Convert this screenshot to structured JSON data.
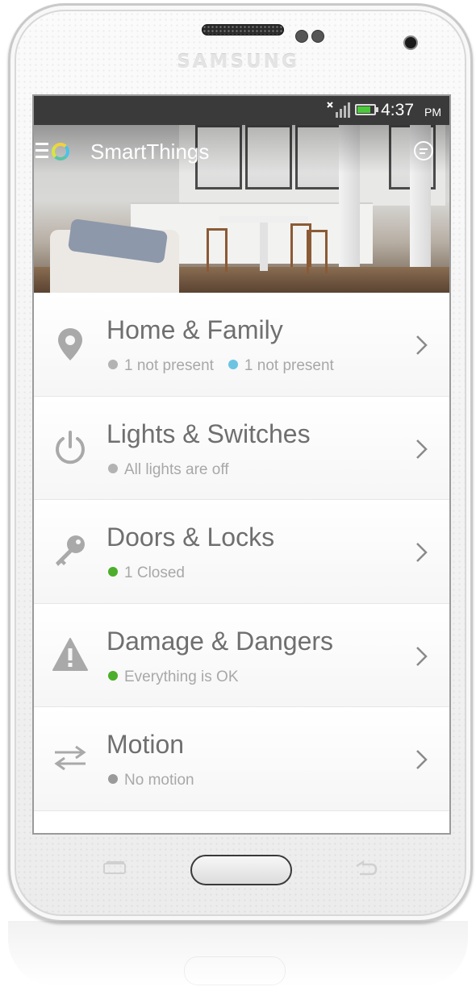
{
  "device": {
    "brand": "SAMSUNG"
  },
  "status_bar": {
    "time": "4:37",
    "ampm": "PM",
    "battery_level": 0.8,
    "icons": [
      "signal-icon",
      "battery-icon"
    ]
  },
  "app_bar": {
    "title": "SmartThings",
    "icons": [
      "menu-icon",
      "smartthings-logo-icon",
      "chat-icon"
    ]
  },
  "colors": {
    "accent_green": "#4cae2a",
    "accent_blue": "#6cc4e2",
    "neutral_gray": "#b3b3b3"
  },
  "list": {
    "items": [
      {
        "title": "Home & Family",
        "icon": "location-pin-icon",
        "statuses": [
          {
            "text": "1 not present",
            "dot_color": "#b3b3b3"
          },
          {
            "text": "1 not present",
            "dot_color": "#6cc4e2"
          }
        ]
      },
      {
        "title": "Lights & Switches",
        "icon": "power-icon",
        "statuses": [
          {
            "text": "All lights are off",
            "dot_color": "#b3b3b3"
          }
        ]
      },
      {
        "title": "Doors & Locks",
        "icon": "key-icon",
        "statuses": [
          {
            "text": "1 Closed",
            "dot_color": "#4cae2a"
          }
        ]
      },
      {
        "title": "Damage & Dangers",
        "icon": "warning-icon",
        "statuses": [
          {
            "text": "Everything is OK",
            "dot_color": "#4cae2a"
          }
        ]
      },
      {
        "title": "Motion",
        "icon": "motion-arrows-icon",
        "statuses": [
          {
            "text": "No motion",
            "dot_color": "#9a9a9a"
          }
        ]
      }
    ]
  }
}
